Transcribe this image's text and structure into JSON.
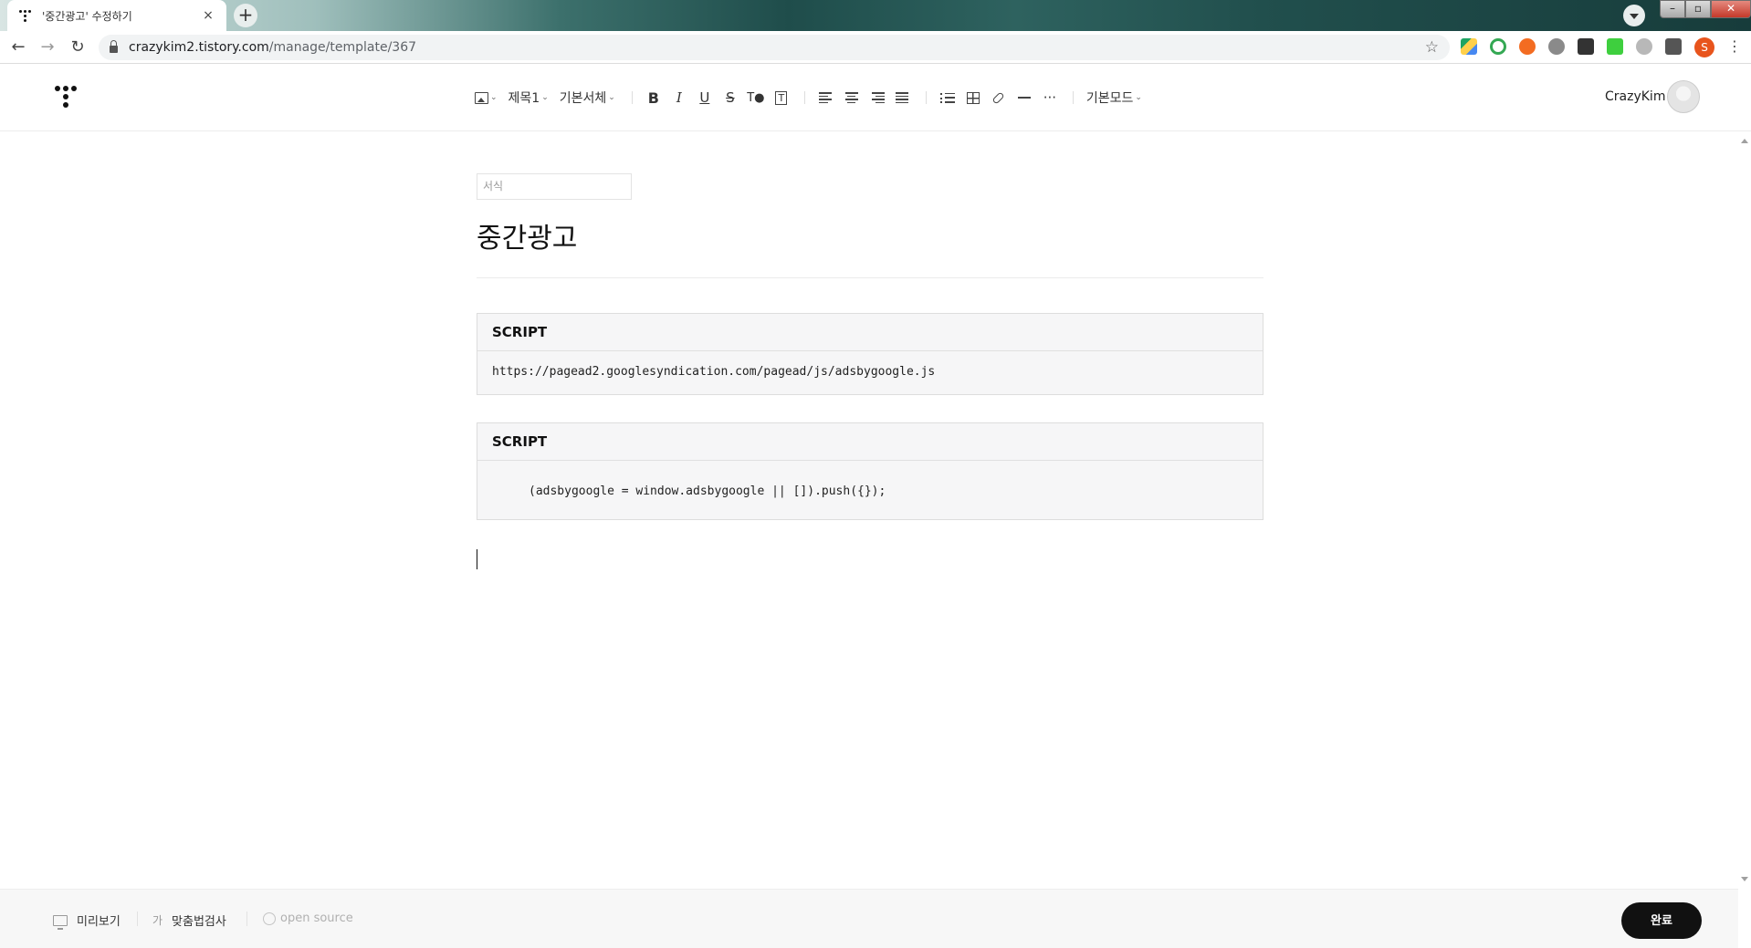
{
  "browser": {
    "tab_title": "'중간광고' 수정하기",
    "tab_close": "×",
    "new_tab": "+",
    "url_host": "crazykim2.tistory.com",
    "url_path": "/manage/template/367",
    "profile_initial": "S",
    "window_controls": {
      "minimize": "–",
      "maximize": "▫",
      "close": "✕"
    },
    "nav": {
      "back": "←",
      "forward": "→",
      "reload": "↻",
      "bookmark": "☆",
      "menu": "⋮"
    }
  },
  "toolbar": {
    "image_icon": "image-icon",
    "heading_label": "제목1",
    "font_label": "기본서체",
    "bold": "B",
    "italic": "I",
    "underline": "U",
    "strike": "S",
    "text_color": "T●",
    "text_bg": "T",
    "more": "···",
    "mode_label": "기본모드"
  },
  "user": {
    "name": "CrazyKim"
  },
  "editor": {
    "category_placeholder": "서식",
    "title": "중간광고",
    "blocks": [
      {
        "label": "SCRIPT",
        "content": "https://pagead2.googlesyndication.com/pagead/js/adsbygoogle.js"
      },
      {
        "label": "SCRIPT",
        "content": "(adsbygoogle = window.adsbygoogle || []).push({});"
      }
    ]
  },
  "footer": {
    "preview": "미리보기",
    "spellcheck": "맞춤법검사",
    "open_source": "open source",
    "done": "완료"
  },
  "colors": {
    "accent": "#111111",
    "tab_strip": "#1f4d4b",
    "profile": "#e8541c"
  }
}
